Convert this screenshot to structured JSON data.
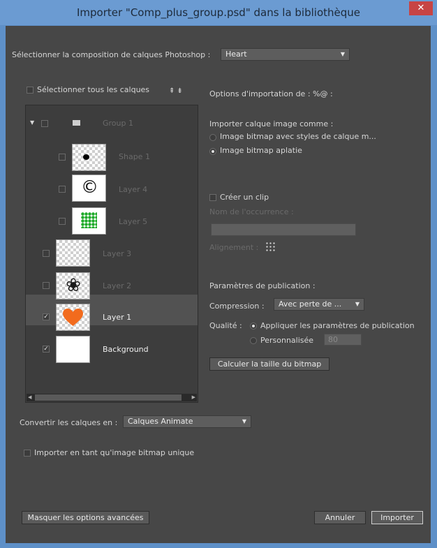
{
  "window": {
    "title": "Importer \"Comp_plus_group.psd\" dans la bibliothèque",
    "close_glyph": "✕"
  },
  "composition": {
    "label": "Sélectionner la composition de calques Photoshop :",
    "value": "Heart"
  },
  "layers": {
    "select_all_label": "Sélectionner tous les calques",
    "sort_icon": "collapse-all-icon",
    "items": [
      {
        "name": "Group 1",
        "checked": false,
        "type": "group",
        "dimmed": true
      },
      {
        "name": "Shape 1",
        "checked": false,
        "type": "layer",
        "dimmed": true
      },
      {
        "name": "Layer 4",
        "checked": false,
        "type": "layer",
        "dimmed": true
      },
      {
        "name": "Layer 5",
        "checked": false,
        "type": "layer",
        "dimmed": true
      },
      {
        "name": "Layer 3",
        "checked": false,
        "type": "layer",
        "dimmed": true
      },
      {
        "name": "Layer 2",
        "checked": false,
        "type": "layer",
        "dimmed": true
      },
      {
        "name": "Layer 1",
        "checked": true,
        "type": "layer",
        "dimmed": false,
        "selected": true
      },
      {
        "name": "Background",
        "checked": true,
        "type": "layer",
        "dimmed": false
      }
    ],
    "check_glyph": "✓",
    "heart_color": "#f26b1d",
    "dots_color": "#1faa2a"
  },
  "options": {
    "title": "Options d'importation de : %@ :",
    "import_as_label": "Importer calque image comme :",
    "radio_styles": "Image bitmap avec styles de calque m...",
    "radio_flat": "Image bitmap aplatie",
    "create_clip": "Créer un clip",
    "instance_name_label": "Nom de l'occurrence :",
    "alignment_label": "Alignement :"
  },
  "publish": {
    "title": "Paramètres de publication :",
    "compression_label": "Compression :",
    "compression_value": "Avec perte de ...",
    "quality_label": "Qualité :",
    "quality_option_publish": "Appliquer les paramètres de publication",
    "quality_option_custom": "Personnalisée",
    "custom_value": "80",
    "calc_button": "Calculer la taille du bitmap"
  },
  "convert": {
    "label": "Convertir les calques en :",
    "value": "Calques Animate"
  },
  "single_bitmap_label": "Importer en tant qu'image bitmap unique",
  "buttons": {
    "advanced": "Masquer les options avancées",
    "cancel": "Annuler",
    "import": "Importer"
  }
}
